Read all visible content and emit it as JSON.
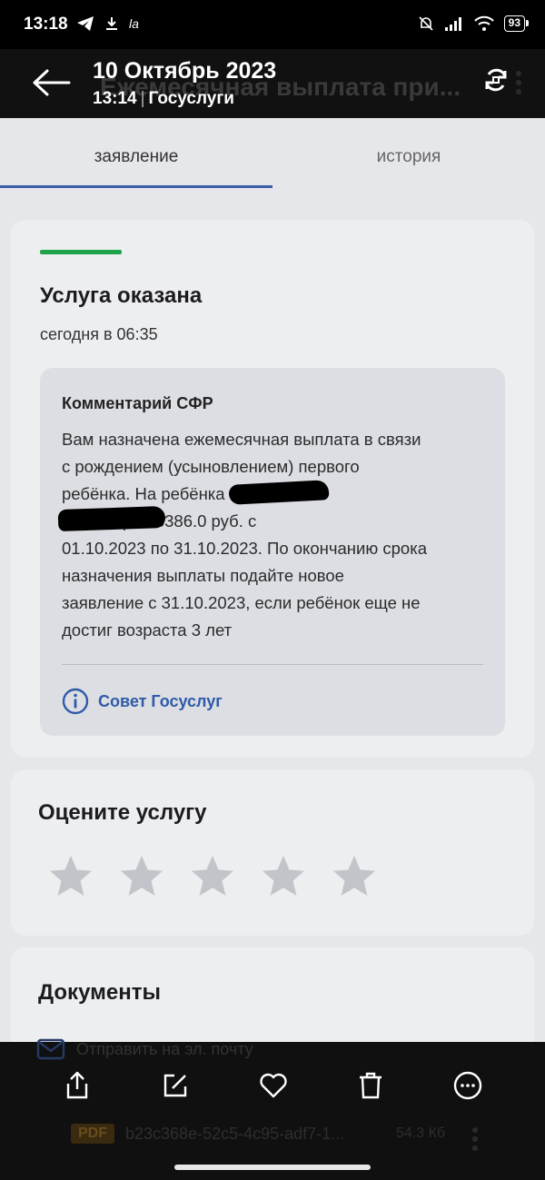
{
  "status_bar": {
    "time": "13:18",
    "carrier_icon_text": "la",
    "battery": "93"
  },
  "notification": {
    "date": "10 Октябрь 2023",
    "time": "13:14",
    "app": "Госуслуги",
    "ghost_title": "Ежемесячная выплата при..."
  },
  "tabs": [
    {
      "label": "заявление",
      "active": true
    },
    {
      "label": "история",
      "active": false
    }
  ],
  "status_card": {
    "title": "Услуга оказана",
    "time": "сегодня в 06:35",
    "comment_title": "Комментарий СФР",
    "comment_text": "Вам назначена ежемесячная выплата в связи\nс рождением (усыновлением) первого\nребёнка. На ребёнка                         в Лев\n                              в размере 13386.0 руб. с\n01.10.2023 по 31.10.2023. По окончанию срока\nназначения выплаты подайте новое\nзаявление с 31.10.2023, если ребёнок еще не\nдостиг возраста 3 лет",
    "advice_label": "Совет Госуслуг"
  },
  "rating": {
    "title": "Оцените услугу",
    "max_stars": 5,
    "selected": 0
  },
  "documents": {
    "title": "Документы",
    "email_label": "Отправить на эл. почту",
    "file": {
      "badge": "PDF",
      "name": "b23c368e-52c5-4c95-adf7-1...",
      "size": "54.3 Кб"
    }
  },
  "colors": {
    "accent": "#2e5aa8",
    "success": "#1fa34a",
    "background": "#e6e7ea"
  }
}
